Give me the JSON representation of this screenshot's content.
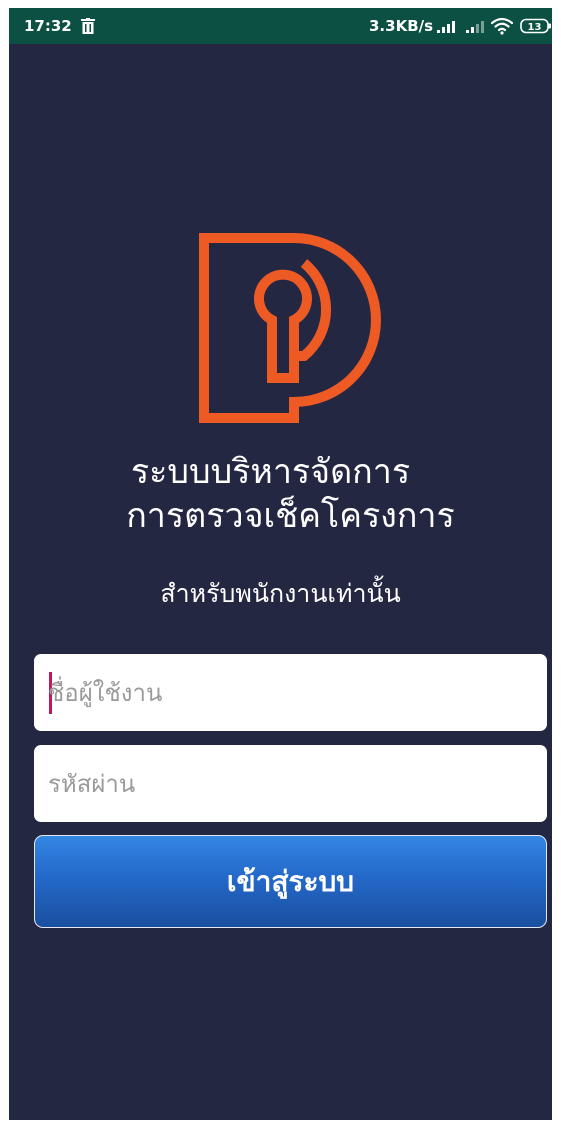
{
  "status_bar": {
    "time": "17:32",
    "network_speed": "3.3KB/s",
    "battery_level": "13",
    "background_color": "#0b5043",
    "icons": [
      "trash-icon",
      "signal-icon",
      "signal-icon",
      "wifi-icon",
      "battery-icon"
    ]
  },
  "app": {
    "background_color": "#232742",
    "logo_color": "#ee5a24",
    "title_line1": "ระบบบริหารจัดการ",
    "title_line2": "การตรวจเช็คโครงการ",
    "subtitle": "สำหรับพนักงานเท่านั้น"
  },
  "login_form": {
    "username_placeholder": "ชื่อผู้ใช้งาน",
    "username_value": "",
    "password_placeholder": "รหัสผ่าน",
    "password_value": "",
    "submit_label": "เข้าสู่ระบบ",
    "button_color": "#2469c9",
    "caret_color": "#c2185b"
  }
}
